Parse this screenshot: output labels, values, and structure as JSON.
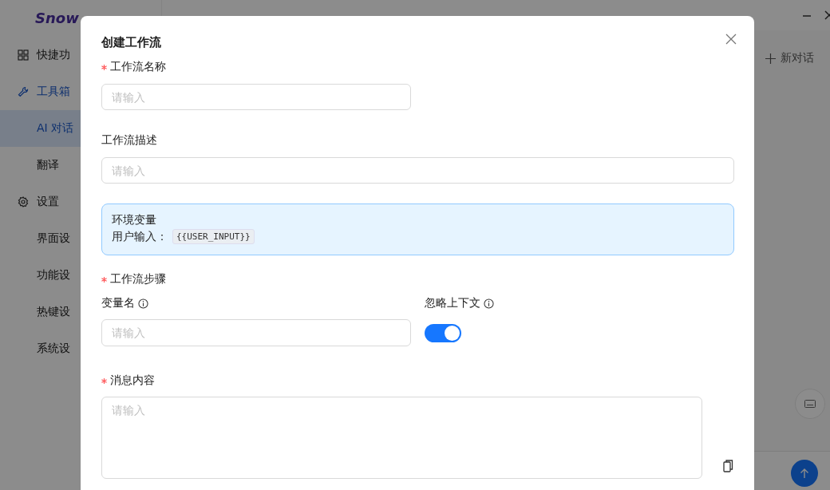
{
  "sidebar": {
    "logo": "Snow",
    "groups": [
      {
        "label": "快捷功",
        "active": false
      },
      {
        "label": "工具箱",
        "active": true,
        "children": [
          {
            "label": "AI 对话",
            "selected": true
          },
          {
            "label": "翻译",
            "selected": false
          }
        ]
      },
      {
        "label": "设置",
        "active": false,
        "children": [
          {
            "label": "界面设",
            "selected": false
          },
          {
            "label": "功能设",
            "selected": false
          },
          {
            "label": "热键设",
            "selected": false
          },
          {
            "label": "系统设",
            "selected": false
          }
        ]
      }
    ]
  },
  "main": {
    "new_chat": "新对话"
  },
  "dialog": {
    "title": "创建工作流",
    "name_field": {
      "label": "工作流名称",
      "required": true,
      "placeholder": "请输入"
    },
    "description_field": {
      "label": "工作流描述",
      "placeholder": "请输入"
    },
    "env_box": {
      "title": "环境变量",
      "label": "用户输入：",
      "code": "{{USER_INPUT}}"
    },
    "steps": {
      "label": "工作流步骤",
      "required": true,
      "variable_field": {
        "label": "变量名",
        "placeholder": "请输入"
      },
      "ignore_context": {
        "label": "忽略上下文",
        "on": true
      },
      "message_field": {
        "label": "消息内容",
        "required": true,
        "placeholder": "请输入"
      }
    }
  }
}
